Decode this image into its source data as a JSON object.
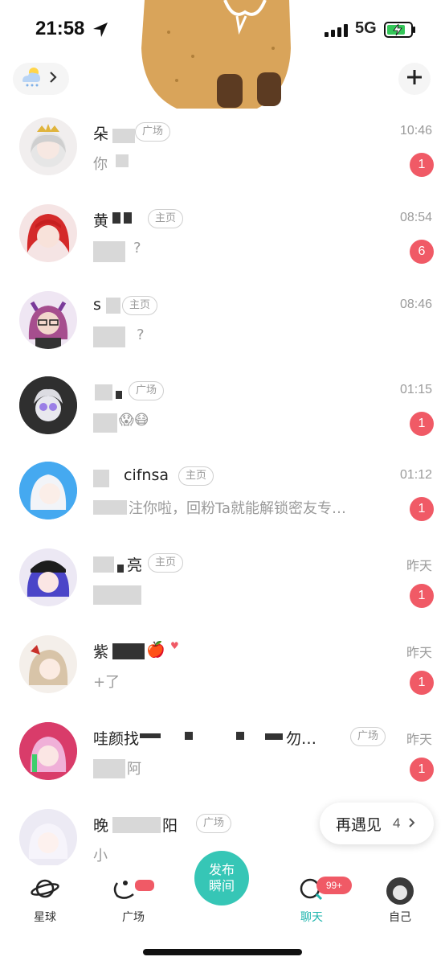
{
  "status_bar": {
    "time": "21:58",
    "network": "5G"
  },
  "header": {
    "weather_icon": "cloud-snow-icon",
    "add_icon": "plus-icon"
  },
  "chats": [
    {
      "name": "朵",
      "tag": "广场",
      "time": "10:46",
      "message": "你",
      "unread": "1"
    },
    {
      "name": "黄",
      "name_suffix": "",
      "tag": "主页",
      "time": "08:54",
      "message": "?",
      "unread": "6"
    },
    {
      "name": "s",
      "tag": "主页",
      "time": "08:46",
      "message": "",
      "message_suffix": "?",
      "unread": ""
    },
    {
      "name": "",
      "tag": "广场",
      "time": "01:15",
      "message": "😱😷",
      "unread": "1"
    },
    {
      "name": "cifnsa",
      "tag": "主页",
      "time": "01:12",
      "message": "注你啦，回粉Ta就能解锁密友专…",
      "unread": "1"
    },
    {
      "name": "亮",
      "tag": "主页",
      "time": "昨天",
      "message": "",
      "unread": "1"
    },
    {
      "name": "紫",
      "name_emoji": "🍎",
      "tag": "",
      "time": "昨天",
      "message": "+了",
      "unread": "1"
    },
    {
      "name": "哇颜找",
      "name_suffix": "勿…",
      "tag": "广场",
      "time": "昨天",
      "message": "阿",
      "unread": "1"
    },
    {
      "name": "晚",
      "name_suffix": "阳",
      "tag": "广场",
      "time": "",
      "message": "小",
      "unread": ""
    }
  ],
  "reencounter": {
    "label": "再遇见",
    "count": "4"
  },
  "tabbar": {
    "items": [
      {
        "label": "星球",
        "icon": "planet-icon"
      },
      {
        "label": "广场",
        "icon": "square-icon"
      },
      {
        "label": "聊天",
        "icon": "chat-icon",
        "badge": "99+"
      },
      {
        "label": "自己",
        "icon": "avatar"
      }
    ],
    "publish_line1": "发布",
    "publish_line2": "瞬间"
  },
  "colors": {
    "accent": "#1fb5ad",
    "badge": "#f05a66",
    "publish": "#36c6b6"
  }
}
